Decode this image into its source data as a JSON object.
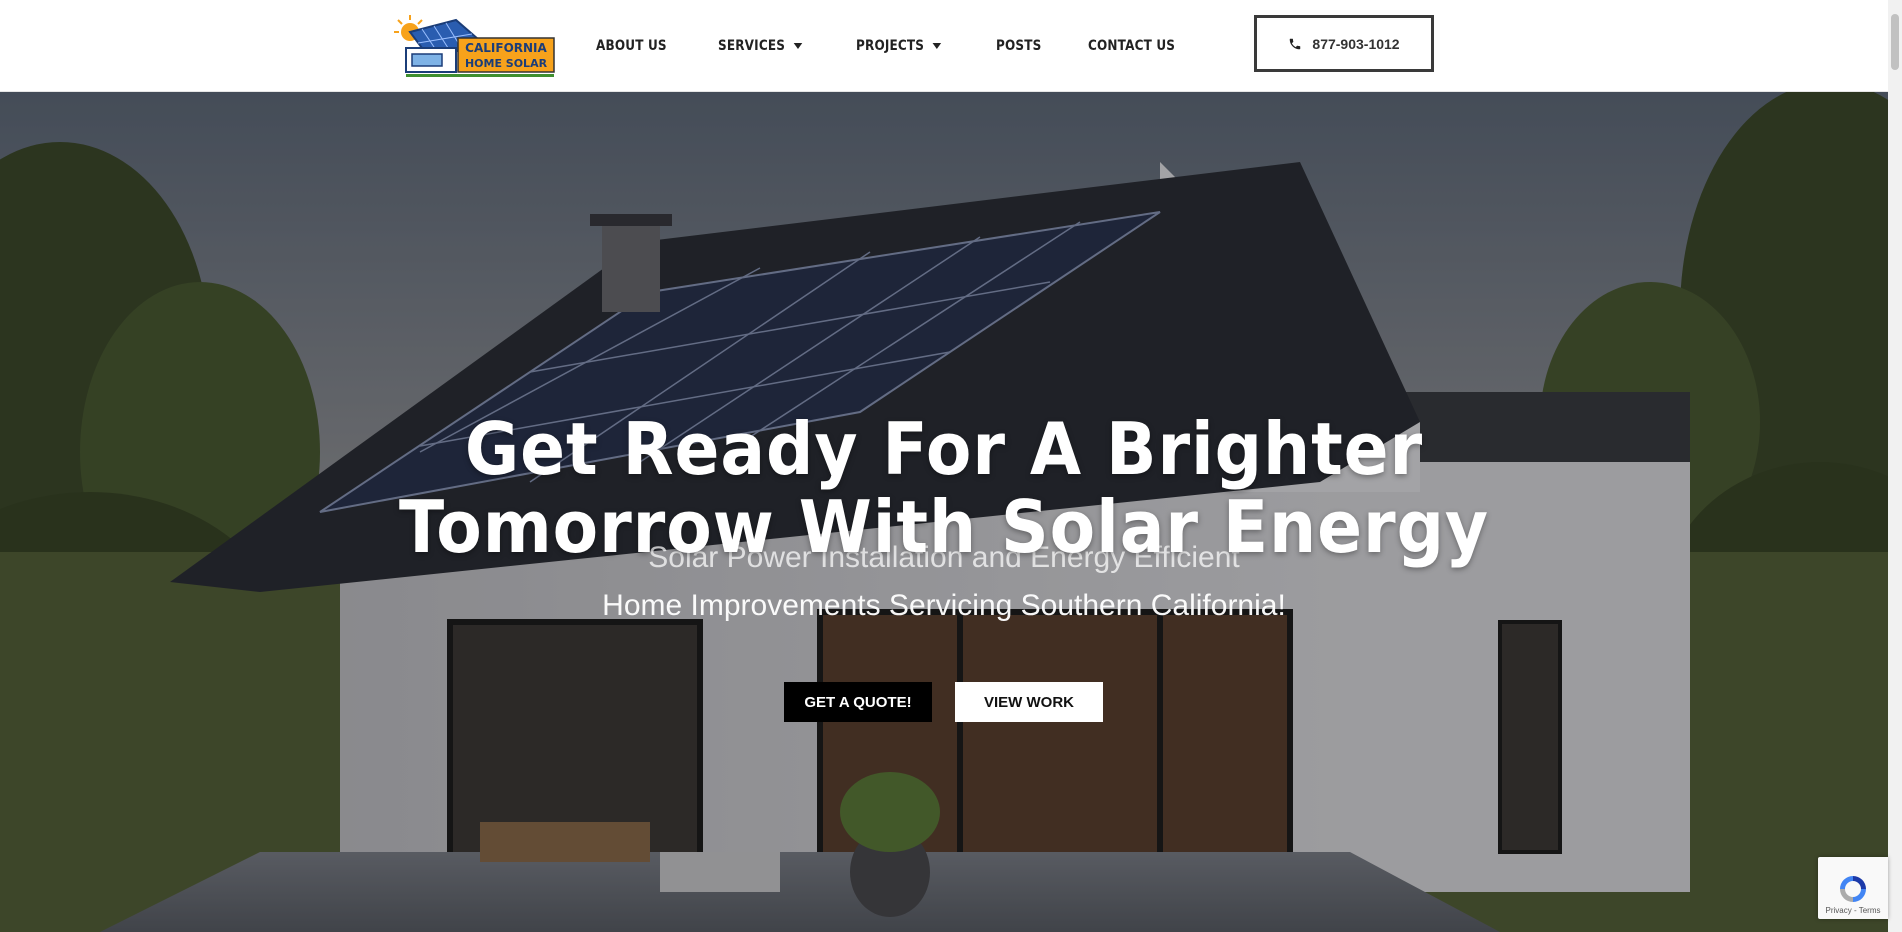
{
  "header": {
    "logo_text_line1": "CALIFORNIA",
    "logo_text_line2": "HOME SOLAR",
    "nav": [
      {
        "label": "ABOUT US",
        "dropdown": false
      },
      {
        "label": "SERVICES",
        "dropdown": true
      },
      {
        "label": "PROJECTS",
        "dropdown": true
      },
      {
        "label": "POSTS",
        "dropdown": false
      },
      {
        "label": "CONTACT US",
        "dropdown": false
      }
    ],
    "phone": "877-903-1012"
  },
  "hero": {
    "title_line1": "Get Ready For A Brighter",
    "title_line2": "Tomorrow With Solar Energy",
    "subtitle_line1": "Solar Power Installation and Energy Efficient",
    "subtitle_line2": "Home Improvements Servicing Southern California!",
    "cta_primary": "GET A QUOTE!",
    "cta_secondary": "VIEW WORK"
  },
  "recaptcha": {
    "links": "Privacy - Terms"
  },
  "colors": {
    "accent": "#000000",
    "logo_orange": "#f7a21b",
    "logo_blue": "#2a5db0",
    "logo_green": "#3f8f2f"
  },
  "icons": {
    "phone": "phone-icon",
    "dropdown": "caret-down-icon",
    "recaptcha": "recaptcha-icon"
  }
}
